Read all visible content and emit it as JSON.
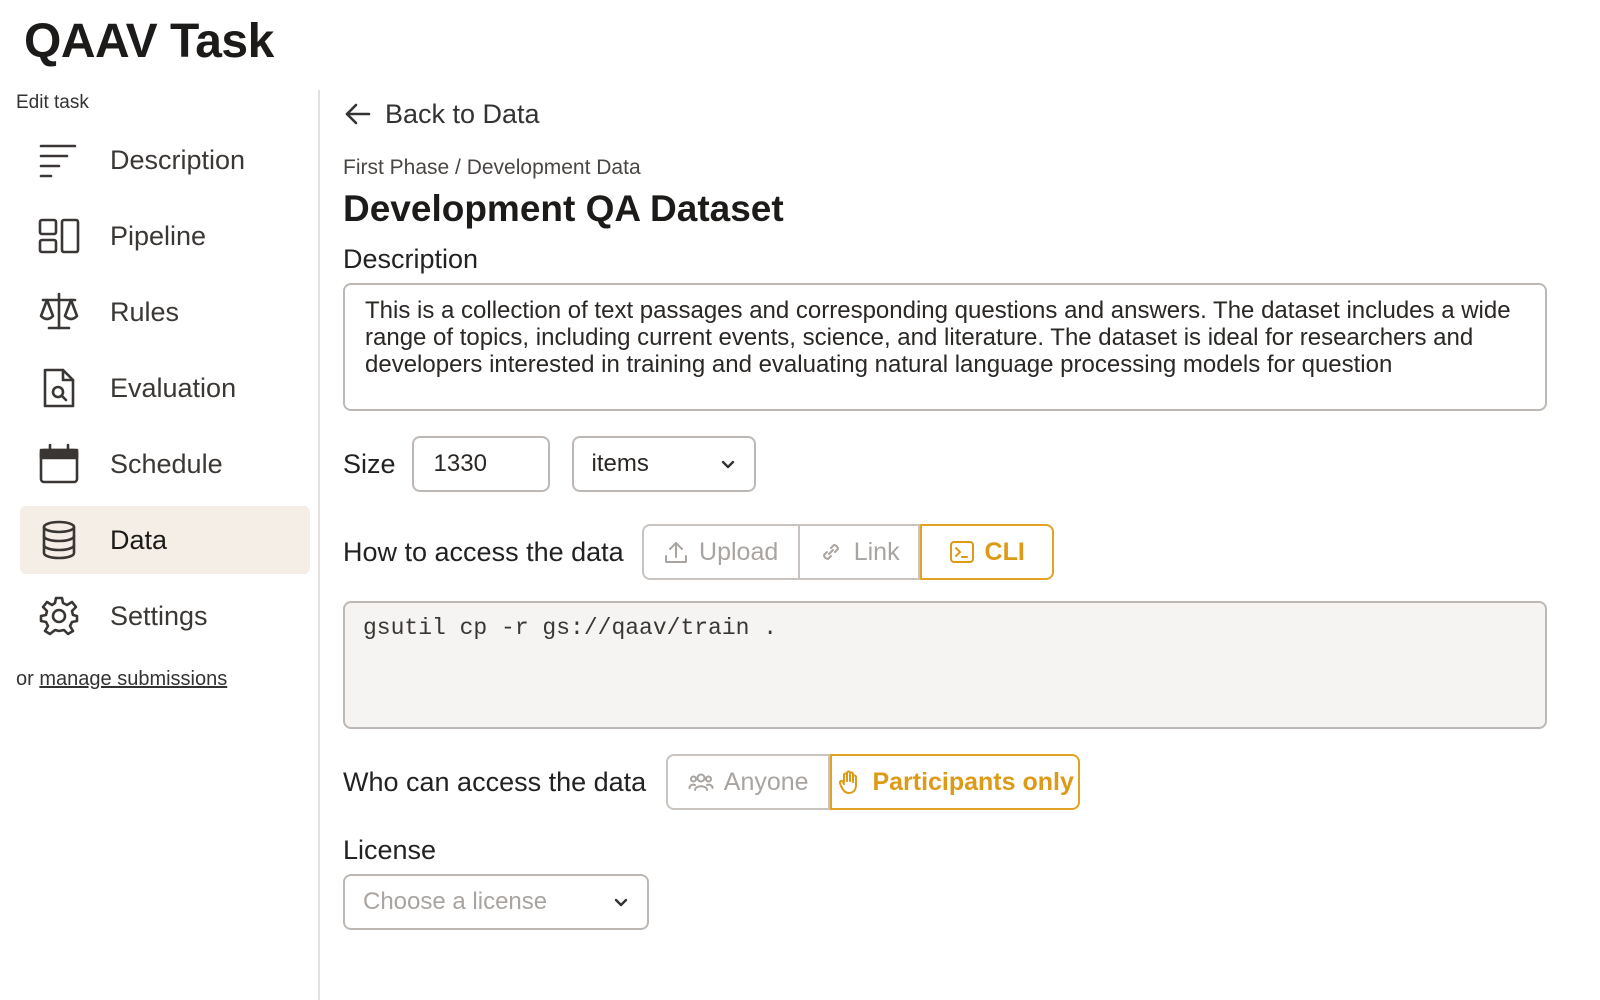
{
  "app": {
    "title": "QAAV Task"
  },
  "sidebar": {
    "section_label": "Edit task",
    "items": [
      {
        "label": "Description",
        "icon": "text-lines-icon"
      },
      {
        "label": "Pipeline",
        "icon": "layout-blocks-icon"
      },
      {
        "label": "Rules",
        "icon": "scale-icon"
      },
      {
        "label": "Evaluation",
        "icon": "document-search-icon"
      },
      {
        "label": "Schedule",
        "icon": "calendar-icon"
      },
      {
        "label": "Data",
        "icon": "database-icon",
        "active": true
      },
      {
        "label": "Settings",
        "icon": "gear-icon"
      }
    ],
    "manage_prefix": "or",
    "manage_link": "manage submissions"
  },
  "main": {
    "back_label": "Back to Data",
    "breadcrumb": "First Phase / Development Data",
    "title": "Development QA Dataset",
    "description_label": "Description",
    "description_text": "This is a collection of text passages and corresponding questions and answers. The dataset includes a wide range of topics, including current events, science, and literature. The dataset is ideal for researchers and developers interested in training and evaluating natural language processing models for question",
    "size_label": "Size",
    "size_value": "1330",
    "size_unit": "items",
    "access_label": "How to access the data",
    "access_options": [
      {
        "label": "Upload",
        "icon": "upload-icon"
      },
      {
        "label": "Link",
        "icon": "link-icon"
      },
      {
        "label": "CLI",
        "icon": "terminal-icon",
        "selected": true
      }
    ],
    "cli_command": "gsutil cp -r gs://qaav/train .",
    "who_label": "Who can access the data",
    "who_options": [
      {
        "label": "Anyone",
        "icon": "users-icon"
      },
      {
        "label": "Participants only",
        "icon": "hand-icon",
        "selected": true
      }
    ],
    "license_label": "License",
    "license_placeholder": "Choose a license"
  },
  "colors": {
    "accent": "#dd9a16",
    "active_bg": "#f4eee6",
    "border": "#bdb8b3",
    "code_bg": "#f5f4f2"
  }
}
